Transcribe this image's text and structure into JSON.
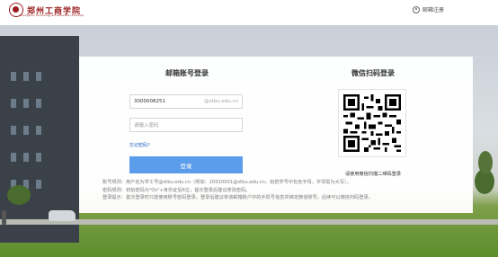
{
  "header": {
    "school_name": "郑州工商学院",
    "school_en": "Zhengzhou Technology and Business University",
    "register_label": "邮箱注册"
  },
  "login": {
    "title": "邮箱账号登录",
    "account_value": "3000008251",
    "account_suffix": "@ztbu.edu.cn",
    "password_placeholder": "请输入密码",
    "forgot_label": "忘记密码?",
    "submit_label": "登录"
  },
  "wechat": {
    "title": "微信扫码登录",
    "caption": "请使用微信扫描二维码登录"
  },
  "rules": [
    "账号规则：用户名为学工号@ztbu.edu.cn（例如：20010001@ztbu.edu.cn，如若学号中包含字母，字母需为大写）。",
    "密码规则：初始密码为\"Os\"+身份证后6位，首次登录后建议修改密码。",
    "登录提示：首次登录时只能使用账号密码登录，登录后建议将该邮箱账户中的手机号信息并绑定微信账号，后续可以微信扫码登录。"
  ],
  "colors": {
    "brand": "#9a1c1c",
    "primary_button": "#5b9dea",
    "link": "#1f5fbf"
  }
}
